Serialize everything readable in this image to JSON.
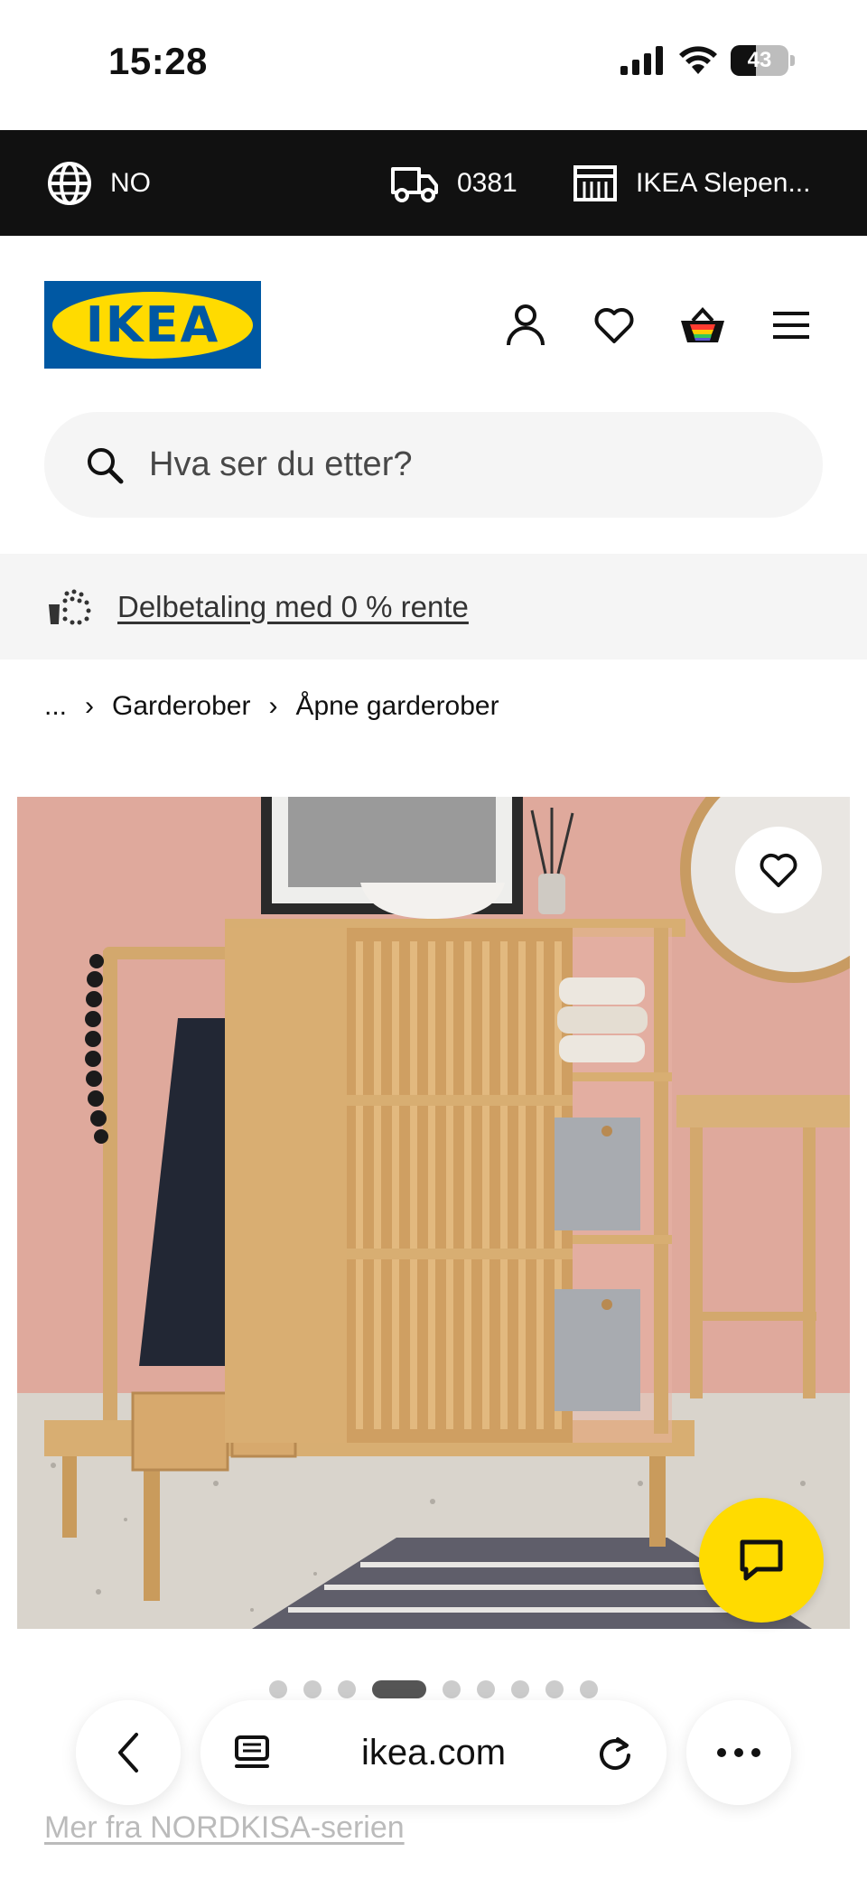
{
  "status": {
    "time": "15:28",
    "battery": "43",
    "battery_level_percent": 43
  },
  "topbar": {
    "country": "NO",
    "postcode": "0381",
    "store": "IKEA Slepen..."
  },
  "header": {
    "logo": "IKEA"
  },
  "search": {
    "placeholder": "Hva ser du etter?"
  },
  "promo": {
    "text": "Delbetaling med 0 % rente"
  },
  "breadcrumb": {
    "ellipsis": "...",
    "items": [
      "Garderober",
      "Åpne garderober"
    ]
  },
  "carousel": {
    "total": 9,
    "active_index": 3
  },
  "series_link": "Mer fra NORDKISA-serien",
  "browser": {
    "url": "ikea.com"
  },
  "colors": {
    "ikea_blue": "#0058a3",
    "ikea_yellow": "#ffdb00",
    "topbar_bg": "#111111"
  }
}
